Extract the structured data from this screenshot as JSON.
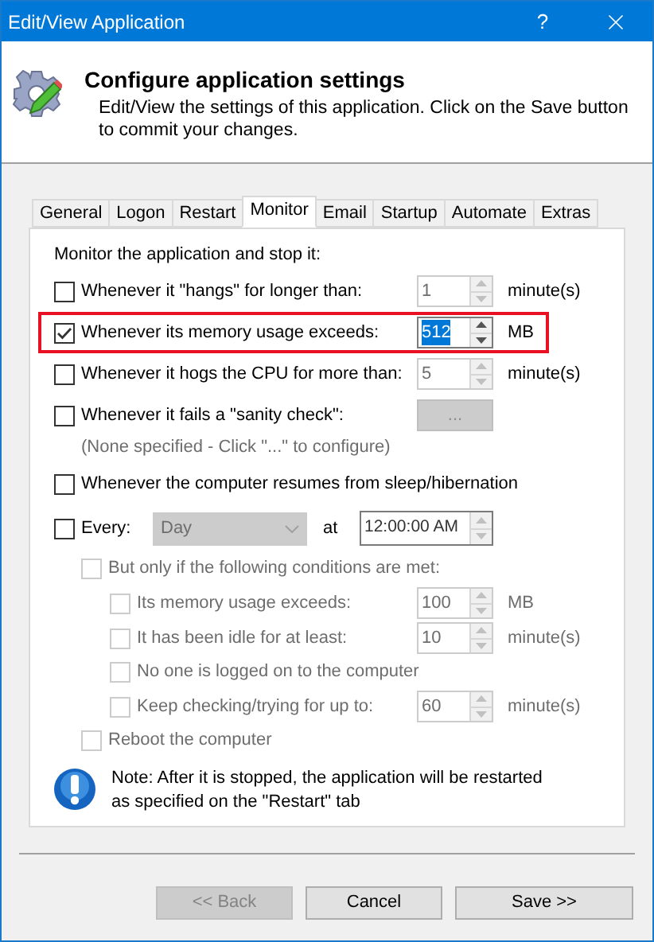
{
  "window": {
    "title": "Edit/View Application",
    "help_button": "?"
  },
  "header": {
    "title": "Configure application settings",
    "description": "Edit/View the settings of this application. Click on the Save button to commit your changes."
  },
  "tabs": [
    {
      "label": "General",
      "selected": false
    },
    {
      "label": "Logon",
      "selected": false
    },
    {
      "label": "Restart",
      "selected": false
    },
    {
      "label": "Monitor",
      "selected": true
    },
    {
      "label": "Email",
      "selected": false
    },
    {
      "label": "Startup",
      "selected": false
    },
    {
      "label": "Automate",
      "selected": false
    },
    {
      "label": "Extras",
      "selected": false
    }
  ],
  "monitor": {
    "heading": "Monitor the application and stop it:",
    "options": [
      {
        "kind": "spin",
        "label": "Whenever it \"hangs\" for longer than:",
        "checked": false,
        "disabled": false,
        "highlighted": false,
        "value": "1",
        "value_selected": false,
        "field_disabled": true,
        "unit": "minute(s)"
      },
      {
        "kind": "spin",
        "label": "Whenever its memory usage exceeds:",
        "checked": true,
        "disabled": false,
        "highlighted": true,
        "value": "512",
        "value_selected": true,
        "field_disabled": false,
        "unit": "MB"
      },
      {
        "kind": "spin",
        "label": "Whenever it hogs the CPU for more than:",
        "checked": false,
        "disabled": false,
        "highlighted": false,
        "value": "5",
        "value_selected": false,
        "field_disabled": true,
        "unit": "minute(s)"
      },
      {
        "kind": "button",
        "label": "Whenever it fails a \"sanity check\":",
        "checked": false,
        "disabled": false,
        "highlighted": false,
        "button": "...",
        "button_disabled": true,
        "hint": "(None specified - Click \"...\" to configure)"
      },
      {
        "kind": "check",
        "label": "Whenever the computer resumes from sleep/hibernation",
        "checked": false,
        "disabled": false,
        "highlighted": false
      },
      {
        "kind": "schedule",
        "label": "Every:",
        "checked": false,
        "disabled": false,
        "highlighted": false,
        "dropdown": "Day",
        "dropdown_disabled": true,
        "at_label": "at",
        "time": "12:00:00 AM",
        "children": [
          {
            "kind": "check",
            "label": "But only if the following conditions are met:",
            "checked": false,
            "disabled": true,
            "children": [
              {
                "kind": "spin",
                "label": "Its memory usage exceeds:",
                "checked": false,
                "disabled": true,
                "value": "100",
                "value_selected": false,
                "field_disabled": true,
                "unit": "MB"
              },
              {
                "kind": "spin",
                "label": "It has been idle for at least:",
                "checked": false,
                "disabled": true,
                "value": "10",
                "value_selected": false,
                "field_disabled": true,
                "unit": "minute(s)"
              },
              {
                "kind": "check",
                "label": "No one is logged on to the computer",
                "checked": false,
                "disabled": true
              },
              {
                "kind": "spin",
                "label": "Keep checking/trying for up to:",
                "checked": false,
                "disabled": true,
                "value": "60",
                "value_selected": false,
                "field_disabled": true,
                "unit": "minute(s)"
              }
            ]
          },
          {
            "kind": "check",
            "label": "Reboot the computer",
            "checked": false,
            "disabled": true
          }
        ]
      }
    ]
  },
  "note": "Note: After it is stopped, the application will be restarted as specified on the \"Restart\" tab",
  "buttons": [
    {
      "label": "<< Back",
      "disabled": true
    },
    {
      "label": "Cancel",
      "disabled": false
    },
    {
      "label": "Save >>",
      "disabled": false
    }
  ]
}
